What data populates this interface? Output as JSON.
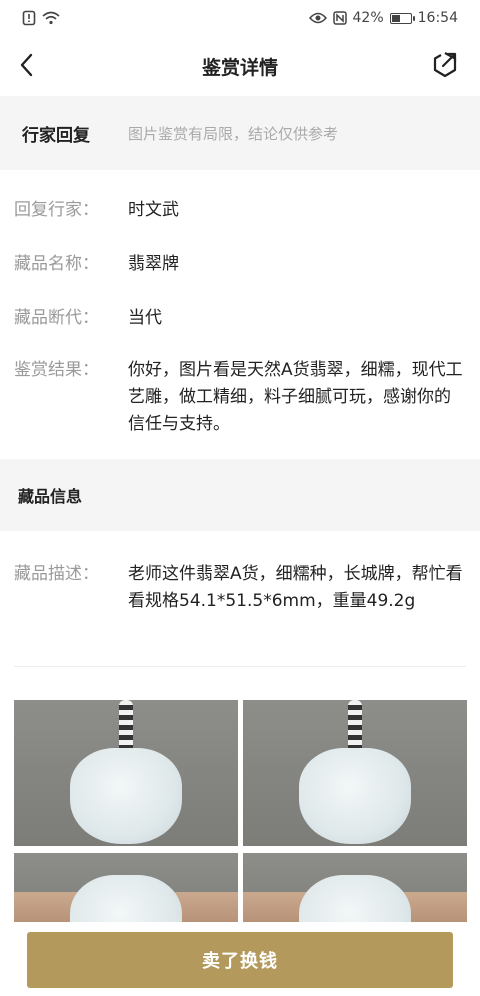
{
  "status_bar": {
    "battery": "42%",
    "time": "16:54",
    "battery_level": 0.42
  },
  "nav": {
    "title": "鉴赏详情",
    "back_icon": "chevron-left-icon",
    "share_icon": "share-icon"
  },
  "reply_section": {
    "title": "行家回复",
    "note": "图片鉴赏有局限，结论仅供参考"
  },
  "reply_fields": [
    {
      "label": "回复行家：",
      "value": "时文武"
    },
    {
      "label": "藏品名称：",
      "value": "翡翠牌"
    },
    {
      "label": "藏品断代：",
      "value": "当代"
    },
    {
      "label": "鉴赏结果：",
      "value": "你好，图片看是天然A货翡翠，细糯，现代工艺雕，做工精细，料子细腻可玩，感谢你的信任与支持。"
    }
  ],
  "info_section": {
    "title": "藏品信息",
    "desc_label": "藏品描述：",
    "desc_value": "老师这件翡翠A货，细糯种，长城牌，帮忙看看规格54.1*51.5*6mm，重量49.2g"
  },
  "footer": {
    "sell_button": "卖了换钱"
  },
  "colors": {
    "accent": "#b39a5c",
    "band_bg": "#f5f5f5",
    "label_gray": "#9a9a9a"
  }
}
